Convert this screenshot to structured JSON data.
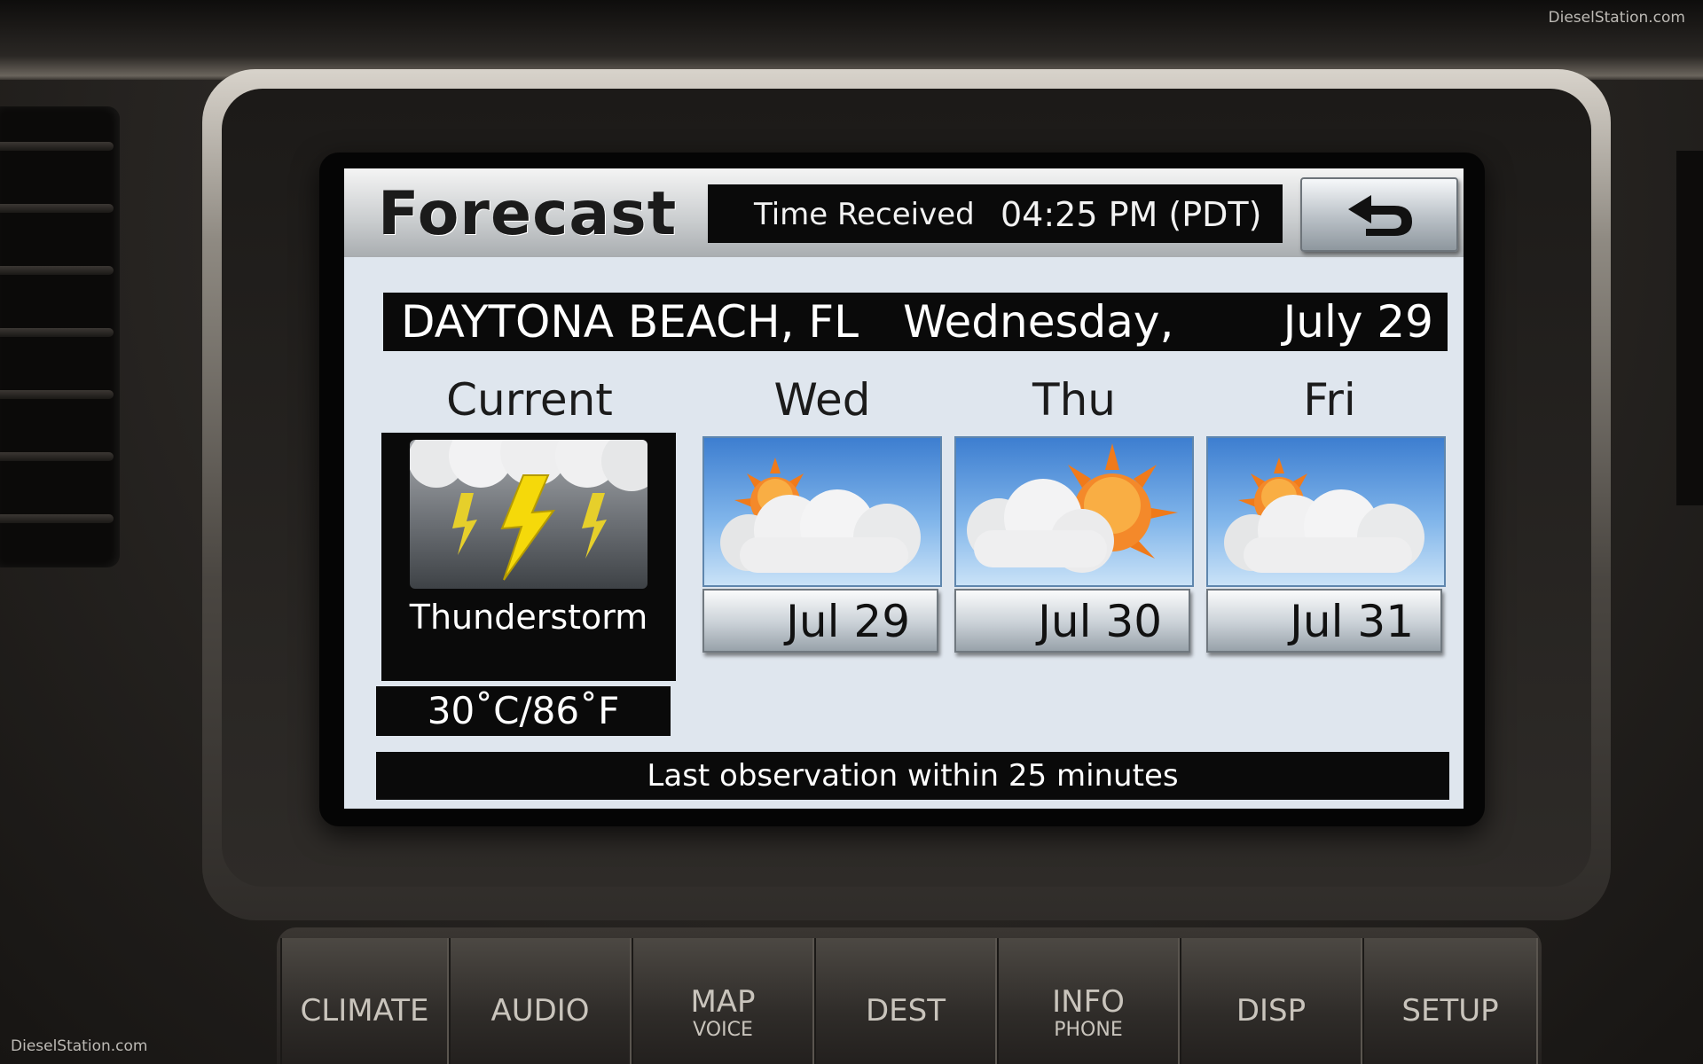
{
  "screen": {
    "title": "Forecast",
    "time_label": "Time Received",
    "time_value": "04:25 PM (PDT)",
    "back_icon": "return-arrow-icon"
  },
  "location": {
    "city": "DAYTONA BEACH, FL",
    "day": "Wednesday,",
    "date": "July 29"
  },
  "current": {
    "label": "Current",
    "condition": "Thunderstorm",
    "temperature": "30˚C/86˚F",
    "icon": "thunderstorm-icon"
  },
  "forecast": [
    {
      "day": "Wed",
      "date": "Jul 29",
      "icon": "partly-cloudy-icon"
    },
    {
      "day": "Thu",
      "date": "Jul 30",
      "icon": "partly-sunny-icon"
    },
    {
      "day": "Fri",
      "date": "Jul 31",
      "icon": "partly-cloudy-icon"
    }
  ],
  "observation": "Last observation  within 25 minutes",
  "hardware_buttons": [
    {
      "label": "CLIMATE"
    },
    {
      "label": "AUDIO"
    },
    {
      "label": "MAP",
      "sub": "VOICE"
    },
    {
      "label": "DEST"
    },
    {
      "label": "INFO",
      "sub": "PHONE"
    },
    {
      "label": "DISP"
    },
    {
      "label": "SETUP"
    }
  ],
  "watermarks": {
    "top_right": "DieselStation.com",
    "bottom_left": "DieselStation.com"
  }
}
